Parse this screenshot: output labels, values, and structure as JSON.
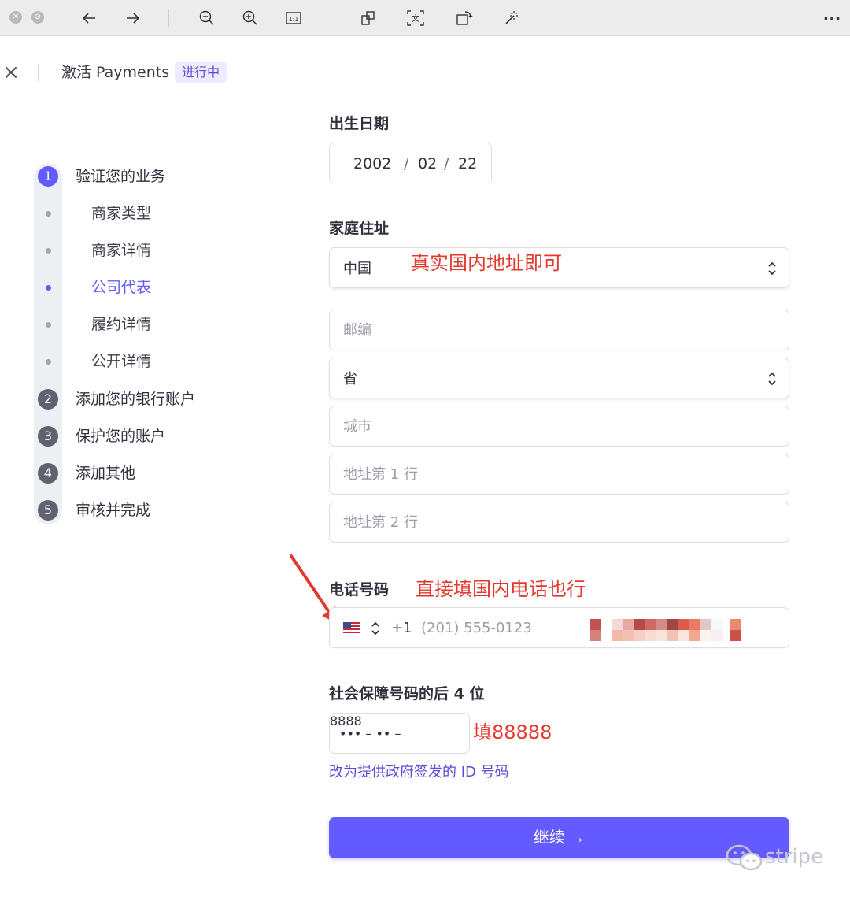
{
  "toolbar": {
    "icons": [
      "close-circle-icon",
      "stop-circle-icon",
      "back-arrow-icon",
      "forward-arrow-icon",
      "zoom-out-icon",
      "zoom-in-icon",
      "actual-size-icon",
      "screenshot-icon",
      "translate-icon",
      "rotate-icon",
      "magic-wand-icon",
      "more-icon"
    ],
    "more_label": "···"
  },
  "header": {
    "close_label": "×",
    "title": "激活 Payments",
    "badge": "进行中"
  },
  "steps": [
    {
      "number": "1",
      "label": "验证您的业务",
      "active": true
    },
    {
      "number": "2",
      "label": "添加您的银行账户",
      "active": false
    },
    {
      "number": "3",
      "label": "保护您的账户",
      "active": false
    },
    {
      "number": "4",
      "label": "添加其他",
      "active": false
    },
    {
      "number": "5",
      "label": "审核并完成",
      "active": false
    }
  ],
  "substeps": [
    {
      "label": "商家类型",
      "active": false
    },
    {
      "label": "商家详情",
      "active": false
    },
    {
      "label": "公司代表",
      "active": true
    },
    {
      "label": "履约详情",
      "active": false
    },
    {
      "label": "公开详情",
      "active": false
    }
  ],
  "form": {
    "dob": {
      "label": "出生日期",
      "year": "2002",
      "month": "02",
      "day": "22",
      "sep": "/"
    },
    "address": {
      "label": "家庭住址",
      "country": "中国",
      "postal_placeholder": "邮编",
      "province": "省",
      "city_placeholder": "城市",
      "line1_placeholder": "地址第 1 行",
      "line2_placeholder": "地址第 2 行"
    },
    "phone": {
      "label": "电话号码",
      "flag": "us-flag-icon",
      "code": "+1",
      "placeholder": "(201) 555-0123"
    },
    "ssn": {
      "label": "社会保障号码的后 4 位",
      "mask": "••• – •• –",
      "placeholder": "8888"
    },
    "id_link": "改为提供政府签发的 ID 号码",
    "continue_label": "继续 →"
  },
  "annotations": {
    "address_note": "真实国内地址即可",
    "phone_note": "直接填国内电话也行",
    "ssn_note": "填88888"
  },
  "watermark": "stripe",
  "colors": {
    "accent": "#635bff",
    "annotation": "#e43a2e"
  }
}
